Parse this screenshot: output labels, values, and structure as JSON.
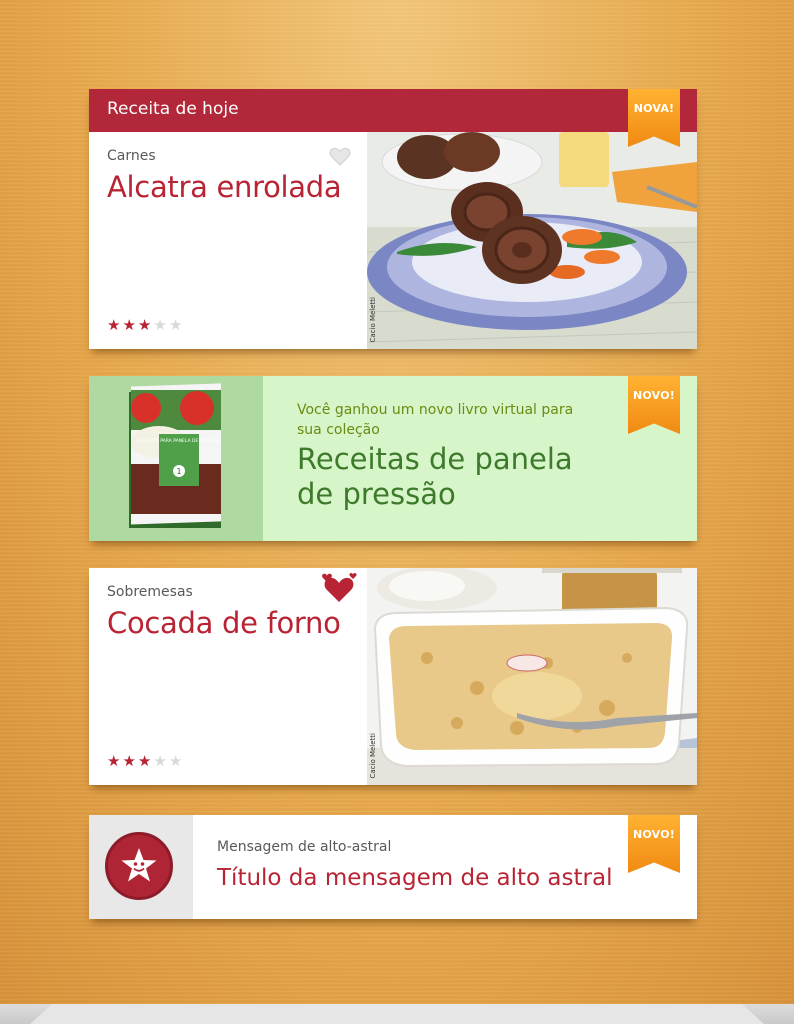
{
  "featured": {
    "header": "Receita de hoje",
    "badge": "NOVA!",
    "category": "Carnes",
    "title": "Alcatra enrolada",
    "rating": 3,
    "rating_max": 5,
    "photo_credit": "Cacio Meletti"
  },
  "book": {
    "badge": "NOVO!",
    "subtitle": "Você ganhou um novo livro virtual para sua coleção",
    "title": "Receitas de panela de pressão",
    "cover": {
      "label": "RECEITAS PARA PANELA DE PRESSÃO",
      "number": "1"
    }
  },
  "recipe2": {
    "category": "Sobremesas",
    "title": "Cocada de forno",
    "rating": 3,
    "rating_max": 5,
    "photo_credit": "Cacio Meletti"
  },
  "message": {
    "badge": "NOVO!",
    "subtitle": "Mensagem de alto-astral",
    "title": "Título da mensagem de alto astral"
  },
  "colors": {
    "brand_red": "#b2283a",
    "badge_orange": "#f18a12",
    "book_green": "#3e7a2b"
  },
  "icons": [
    "heart-outline-icon",
    "hearts-icon",
    "smiley-star-icon",
    "star-icon"
  ]
}
